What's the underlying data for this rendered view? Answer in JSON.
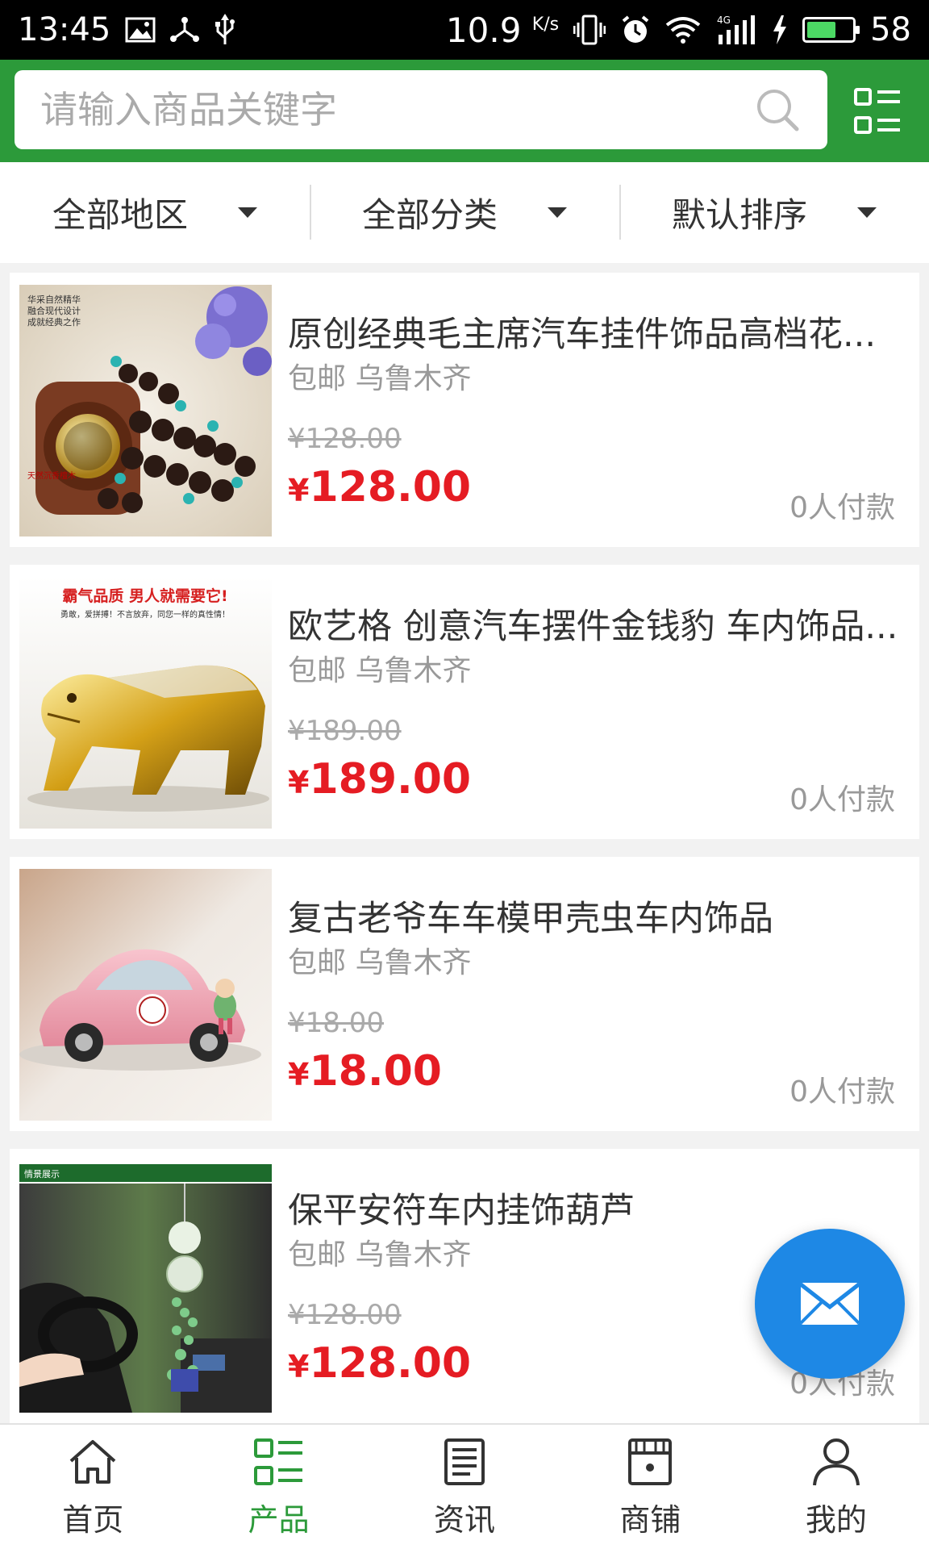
{
  "status_bar": {
    "time": "13:45",
    "network_speed": "10.9",
    "network_unit": "K/s",
    "signal_type": "4G",
    "battery_level": "58"
  },
  "search": {
    "placeholder": "请输入商品关键字"
  },
  "filters": [
    {
      "label": "全部地区"
    },
    {
      "label": "全部分类"
    },
    {
      "label": "默认排序"
    }
  ],
  "products": [
    {
      "title": "原创经典毛主席汽车挂件饰品高档花...",
      "meta": "包邮 乌鲁木齐",
      "old_price": "¥128.00",
      "currency": "¥",
      "price": "128.00",
      "sold": "0人付款",
      "image_caption": "天然沉香檀木"
    },
    {
      "title": "欧艺格 创意汽车摆件金钱豹 车内饰品...",
      "meta": "包邮 乌鲁木齐",
      "old_price": "¥189.00",
      "currency": "¥",
      "price": "189.00",
      "sold": "0人付款",
      "image_caption": "霸气品质 男人就需要它!",
      "image_subcaption": "勇敢，爱拼搏！不言放弃，同您一样的真性情！"
    },
    {
      "title": "复古老爷车车模甲壳虫车内饰品",
      "meta": "包邮 乌鲁木齐",
      "old_price": "¥18.00",
      "currency": "¥",
      "price": "18.00",
      "sold": "0人付款"
    },
    {
      "title": "保平安符车内挂饰葫芦",
      "meta": "包邮 乌鲁木齐",
      "old_price": "¥128.00",
      "currency": "¥",
      "price": "128.00",
      "sold": "0人付款",
      "image_caption": "情景展示"
    }
  ],
  "bottom_nav": [
    {
      "label": "首页",
      "icon": "home-icon",
      "active": false
    },
    {
      "label": "产品",
      "icon": "grid-list-icon",
      "active": true
    },
    {
      "label": "资讯",
      "icon": "news-icon",
      "active": false
    },
    {
      "label": "商铺",
      "icon": "store-icon",
      "active": false
    },
    {
      "label": "我的",
      "icon": "user-icon",
      "active": false
    }
  ],
  "colors": {
    "brand_green": "#2c9a3a",
    "price_red": "#e51c23",
    "fab_blue": "#1e88e5"
  }
}
